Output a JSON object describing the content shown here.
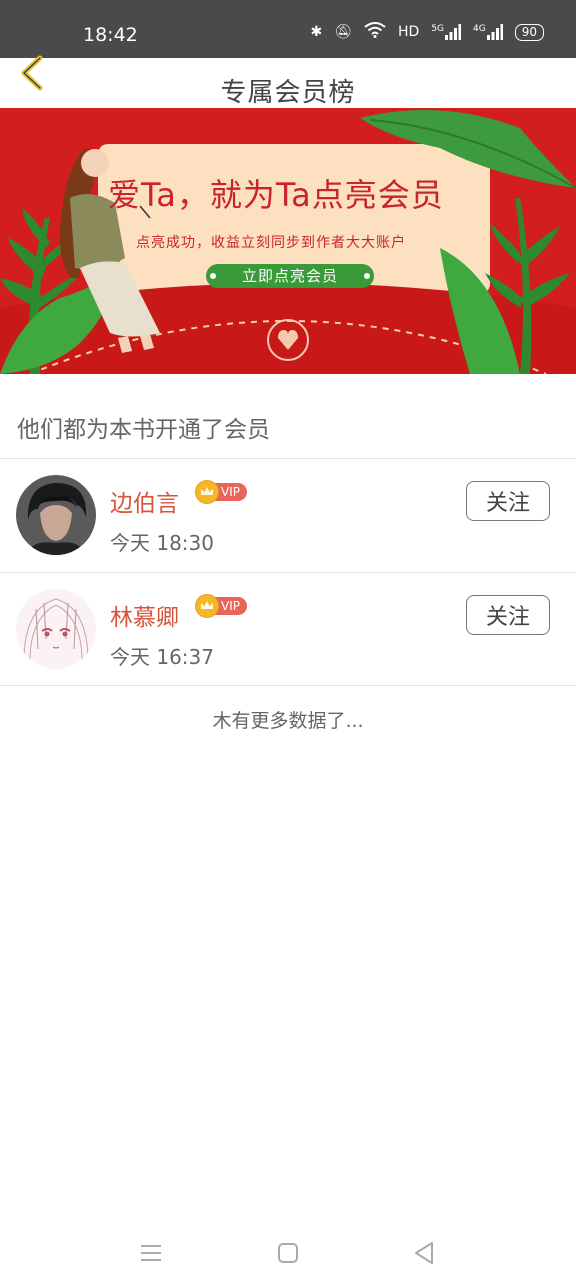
{
  "status_bar": {
    "time": "18:42",
    "icons": [
      "bluetooth-icon",
      "bell-muted-icon",
      "wifi-icon",
      "hd-icon",
      "signal-5g-icon",
      "signal-4g-icon"
    ],
    "hd": "HD",
    "net1": "5G",
    "net2": "4G",
    "battery": "90"
  },
  "nav": {
    "title": "专属会员榜",
    "back_icon": "chevron-left-icon",
    "back_color": "#e0c232"
  },
  "banner": {
    "headline": "爱Ta，就为Ta点亮会员",
    "subline": "点亮成功，收益立刻同步到作者大大账户",
    "button": "立即点亮会员",
    "bg_color": "#d21e1e",
    "card_color": "#fde0c0",
    "button_color": "#3a9a3a"
  },
  "section_title": "他们都为本书开通了会员",
  "members": [
    {
      "name": "边伯言",
      "vip": "VIP",
      "time": "今天 18:30",
      "follow": "关注"
    },
    {
      "name": "林慕卿",
      "vip": "VIP",
      "time": "今天 16:37",
      "follow": "关注"
    }
  ],
  "footer": "木有更多数据了...",
  "system_nav": [
    "menu-icon",
    "home-icon",
    "back-triangle-icon"
  ]
}
